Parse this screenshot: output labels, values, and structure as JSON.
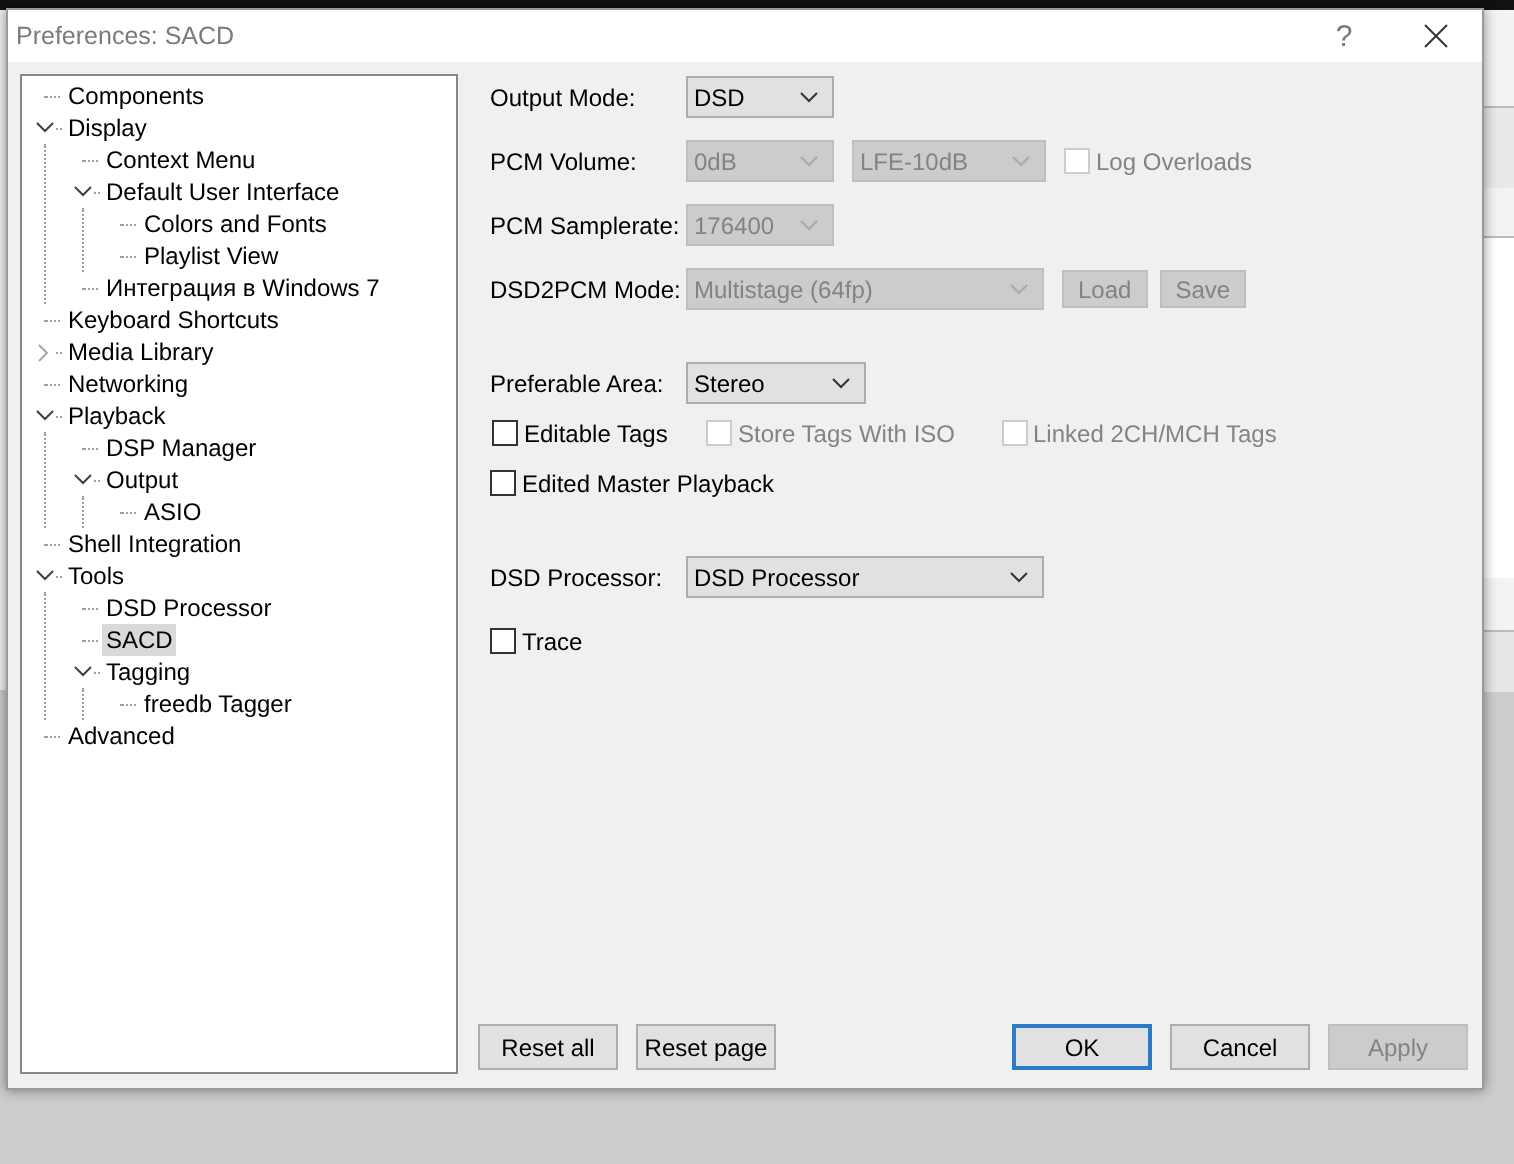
{
  "window": {
    "title": "Preferences: SACD",
    "help_button": "?"
  },
  "tree": [
    {
      "label": "Components",
      "kind": "leaf",
      "selected": false
    },
    {
      "label": "Display",
      "kind": "branch",
      "expanded": true,
      "selected": false,
      "children": [
        {
          "label": "Context Menu",
          "kind": "leaf",
          "selected": false
        },
        {
          "label": "Default User Interface",
          "kind": "branch",
          "expanded": true,
          "selected": false,
          "children": [
            {
              "label": "Colors and Fonts",
              "kind": "leaf",
              "selected": false
            },
            {
              "label": "Playlist View",
              "kind": "leaf",
              "selected": false
            }
          ]
        },
        {
          "label": "Интеграция в Windows 7",
          "kind": "leaf",
          "selected": false
        }
      ]
    },
    {
      "label": "Keyboard Shortcuts",
      "kind": "leaf",
      "selected": false
    },
    {
      "label": "Media Library",
      "kind": "branch",
      "expanded": false,
      "selected": false
    },
    {
      "label": "Networking",
      "kind": "leaf",
      "selected": false
    },
    {
      "label": "Playback",
      "kind": "branch",
      "expanded": true,
      "selected": false,
      "children": [
        {
          "label": "DSP Manager",
          "kind": "leaf",
          "selected": false
        },
        {
          "label": "Output",
          "kind": "branch",
          "expanded": true,
          "selected": false,
          "children": [
            {
              "label": "ASIO",
              "kind": "leaf",
              "selected": false
            }
          ]
        }
      ]
    },
    {
      "label": "Shell Integration",
      "kind": "leaf",
      "selected": false
    },
    {
      "label": "Tools",
      "kind": "branch",
      "expanded": true,
      "selected": false,
      "children": [
        {
          "label": "DSD Processor",
          "kind": "leaf",
          "selected": false
        },
        {
          "label": "SACD",
          "kind": "leaf",
          "selected": true
        },
        {
          "label": "Tagging",
          "kind": "branch",
          "expanded": true,
          "selected": false,
          "children": [
            {
              "label": "freedb Tagger",
              "kind": "leaf",
              "selected": false
            }
          ]
        }
      ]
    },
    {
      "label": "Advanced",
      "kind": "leaf",
      "selected": false
    }
  ],
  "settings": [
    {
      "rows": [
        {
          "label": "Output Mode:",
          "controls": [
            {
              "kind": "dropdown",
              "value": "DSD",
              "disabled": false
            }
          ]
        },
        {
          "label": "PCM Volume:",
          "controls": [
            {
              "kind": "dropdown",
              "value": "0dB",
              "disabled": true
            },
            {
              "kind": "dropdown",
              "value": "LFE-10dB",
              "disabled": true
            },
            {
              "kind": "checkbox",
              "text": "Log Overloads",
              "checked": false,
              "disabled": true
            }
          ]
        },
        {
          "label": "PCM Samplerate:",
          "controls": [
            {
              "kind": "dropdown",
              "value": "176400",
              "disabled": true
            }
          ]
        },
        {
          "label": "DSD2PCM Mode:",
          "controls": [
            {
              "kind": "dropdown",
              "value": "Multistage (64fp)",
              "disabled": true
            },
            {
              "kind": "button",
              "text": "Load",
              "disabled": true
            },
            {
              "kind": "button",
              "text": "Save",
              "disabled": true
            }
          ]
        }
      ]
    },
    {
      "rows": [
        {
          "label": "Preferable Area:",
          "controls": [
            {
              "kind": "dropdown",
              "value": "Stereo",
              "disabled": false
            }
          ]
        },
        {
          "controls": [
            {
              "kind": "checkbox",
              "text": "Editable Tags",
              "checked": false,
              "disabled": false
            },
            {
              "kind": "checkbox",
              "text": "Store Tags With ISO",
              "checked": false,
              "disabled": true
            },
            {
              "kind": "checkbox",
              "text": "Linked 2CH/MCH Tags",
              "checked": false,
              "disabled": true
            }
          ]
        },
        {
          "controls": [
            {
              "kind": "checkbox",
              "text": "Edited Master Playback",
              "checked": false,
              "disabled": false
            }
          ]
        }
      ]
    },
    {
      "rows": [
        {
          "label": "DSD Processor:",
          "controls": [
            {
              "kind": "dropdown",
              "value": "DSD Processor",
              "disabled": false
            }
          ]
        },
        {
          "controls": [
            {
              "kind": "checkbox",
              "text": "Trace",
              "checked": false,
              "disabled": false
            }
          ]
        }
      ]
    }
  ],
  "page_buttons": [
    {
      "label": "Reset all",
      "disabled": false,
      "default": false
    },
    {
      "label": "Reset page",
      "disabled": false,
      "default": false
    }
  ],
  "dialog_buttons": [
    {
      "label": "OK",
      "disabled": false,
      "default": true
    },
    {
      "label": "Cancel",
      "disabled": false,
      "default": false
    },
    {
      "label": "Apply",
      "disabled": true,
      "default": false
    }
  ]
}
